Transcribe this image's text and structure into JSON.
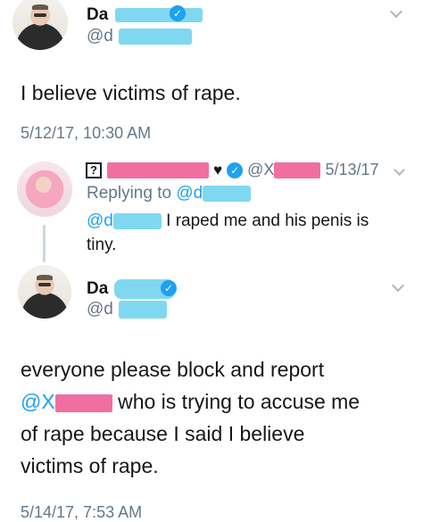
{
  "tweet1": {
    "name": "Da",
    "handle": "@d",
    "text": "I believe victims of rape.",
    "timestamp": "5/12/17, 10:30 AM"
  },
  "reply": {
    "name_box_glyph": "?",
    "heart": "♥",
    "handle": "@X",
    "date": "5/13/17",
    "replying_label": "Replying to",
    "replying_handle": "@d",
    "mention": "@d",
    "text_rest": "I raped me and his penis is",
    "text_line2": "tiny."
  },
  "tweet2": {
    "name": "Da",
    "handle": "@d",
    "text_line1": "everyone please block and report",
    "mention": "@X",
    "text_line2_rest": "who is trying to accuse me",
    "text_line3": "of rape because I said I believe",
    "text_line4": "victims of rape.",
    "timestamp": "5/14/17, 7:53 AM"
  },
  "colors": {
    "link": "#1da1f2",
    "meta": "#657786",
    "redact_pink": "#f06fa0",
    "redact_blue": "#7fd8f0"
  },
  "icons": {
    "verified": "verified-badge-icon",
    "menu": "chevron-down-icon"
  }
}
